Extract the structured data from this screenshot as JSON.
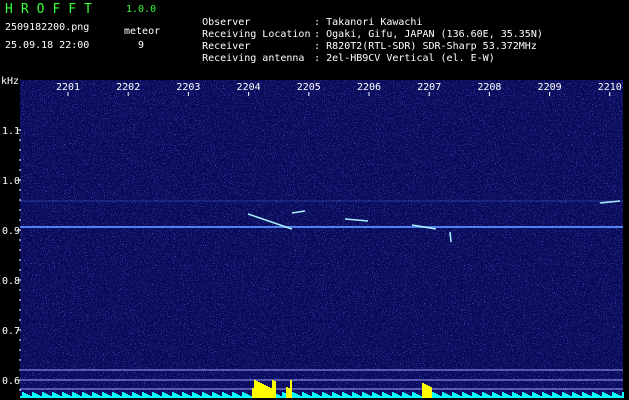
{
  "header": {
    "app_name": "HROFFT",
    "app_version": "1.0.0",
    "file_name": "2509182200.png",
    "datetime": "25.09.18 22:00",
    "meteor_label": "meteor",
    "meteor_count": "9"
  },
  "info": [
    {
      "label": "Observer",
      "value": ": Takanori Kawachi"
    },
    {
      "label": "Receiving Location",
      "value": ": Ogaki, Gifu, JAPAN (136.60E, 35.35N)"
    },
    {
      "label": "Receiver",
      "value": ": R820T2(RTL-SDR) SDR-Sharp 53.372MHz"
    },
    {
      "label": "Receiving antenna",
      "value": ": 2el-HB9CV Vertical (el. E-W)"
    }
  ],
  "axis": {
    "unit": "kHz",
    "time_ticks": [
      "2201",
      "2202",
      "2203",
      "2204",
      "2205",
      "2206",
      "2207",
      "2208",
      "2209",
      "2210"
    ],
    "freq_ticks": [
      "1.1",
      "1.0",
      "0.9",
      "0.8",
      "0.7",
      "0.6"
    ]
  },
  "colors": {
    "background": "#000000",
    "spectrogram_bg": "#0a0a5a",
    "carrier_line": "#5a8cff",
    "meteor_trace": "#aaf0ff",
    "marker_line": "#9fa0ff",
    "activity_bar": "#00ffff",
    "activity_peak": "#ffff00",
    "title_green": "#33ff33"
  }
}
